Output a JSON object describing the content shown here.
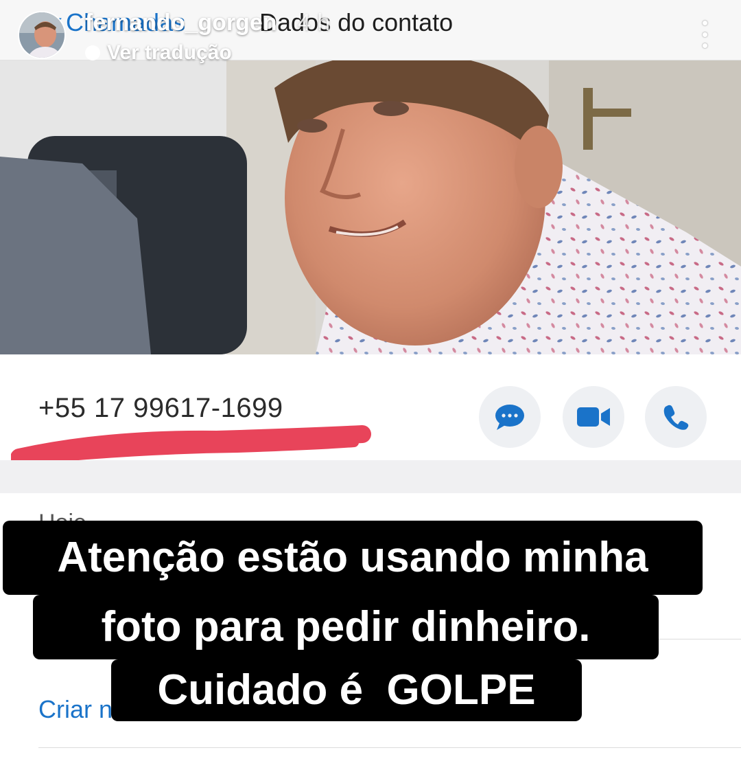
{
  "story": {
    "username": "fernando_gorgen",
    "time": "4 h",
    "translate_label": "Ver tradução",
    "icons": {
      "avatar": "profile-avatar",
      "more": "more-vertical-icon",
      "translate": "translate-dot-icon"
    }
  },
  "whatsapp": {
    "back_label": "Chamadas",
    "title": "Dados do contato",
    "phone_number": "+55 17 99617-1699",
    "list_peek": "Hoje",
    "create_link": "Criar n",
    "actions": [
      {
        "name": "message-button",
        "icon": "chat-bubble-icon"
      },
      {
        "name": "video-call-button",
        "icon": "video-camera-icon"
      },
      {
        "name": "voice-call-button",
        "icon": "phone-icon"
      }
    ],
    "accent_color": "#1a73c9",
    "underline_color": "#e8445a"
  },
  "caption": {
    "line1": "Atenção estão usando minha",
    "line2": "foto para pedir dinheiro.",
    "line3": "Cuidado é  GOLPE"
  }
}
